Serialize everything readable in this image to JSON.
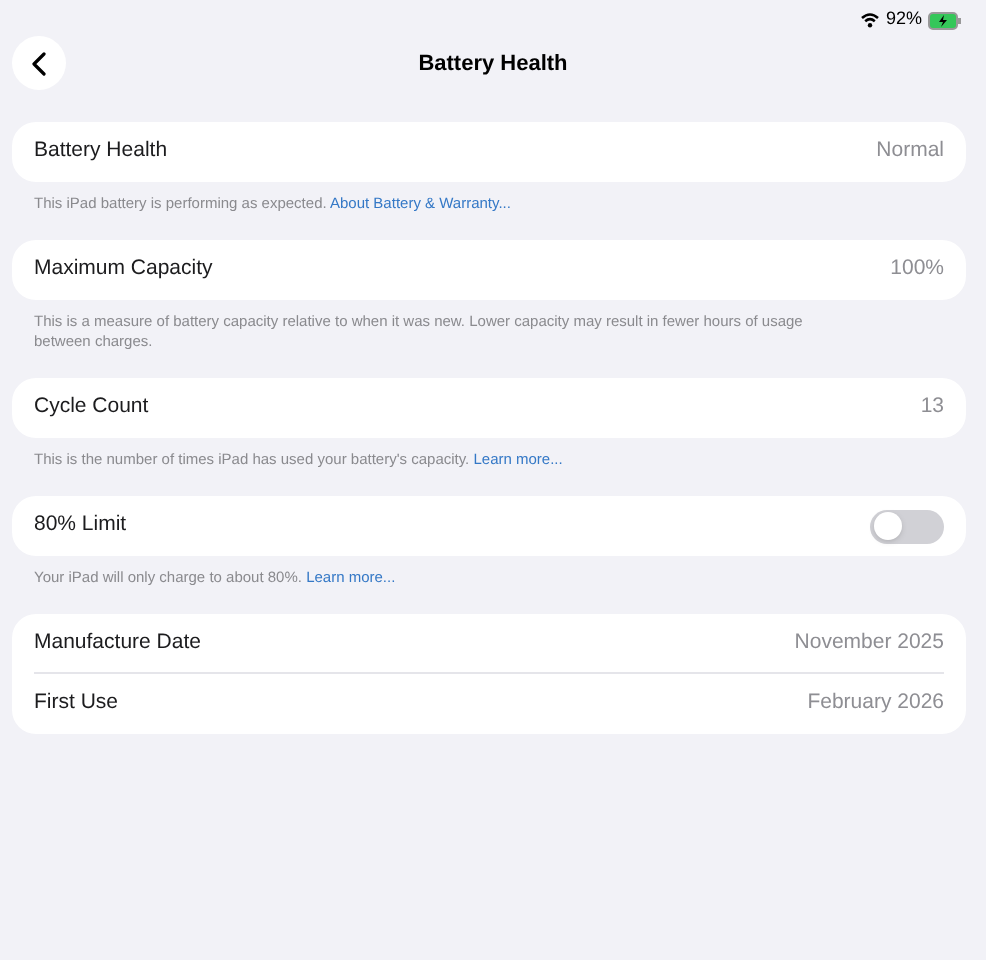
{
  "status_bar": {
    "battery_percent": "92%",
    "charging": true
  },
  "header": {
    "title": "Battery Health"
  },
  "sections": [
    {
      "rows": [
        {
          "kind": "value",
          "label": "Battery Health",
          "value": "Normal"
        }
      ],
      "footer": {
        "text": "This iPad battery is performing as expected.",
        "link": "About Battery & Warranty..."
      }
    },
    {
      "rows": [
        {
          "kind": "value",
          "label": "Maximum Capacity",
          "value": "100%"
        }
      ],
      "footer": {
        "text": "This is a measure of battery capacity relative to when it was new. Lower capacity may result in fewer hours of usage between charges."
      }
    },
    {
      "rows": [
        {
          "kind": "value",
          "label": "Cycle Count",
          "value": "13"
        }
      ],
      "footer": {
        "text": "This is the number of times iPad has used your battery's capacity.",
        "link": "Learn more..."
      }
    },
    {
      "rows": [
        {
          "kind": "toggle",
          "label": "80% Limit",
          "on": false
        }
      ],
      "footer": {
        "text": "Your iPad will only charge to about 80%.",
        "link": "Learn more..."
      }
    },
    {
      "rows": [
        {
          "kind": "value",
          "label": "Manufacture Date",
          "value": "November 2025"
        },
        {
          "kind": "value",
          "label": "First Use",
          "value": "February 2026"
        }
      ]
    }
  ]
}
